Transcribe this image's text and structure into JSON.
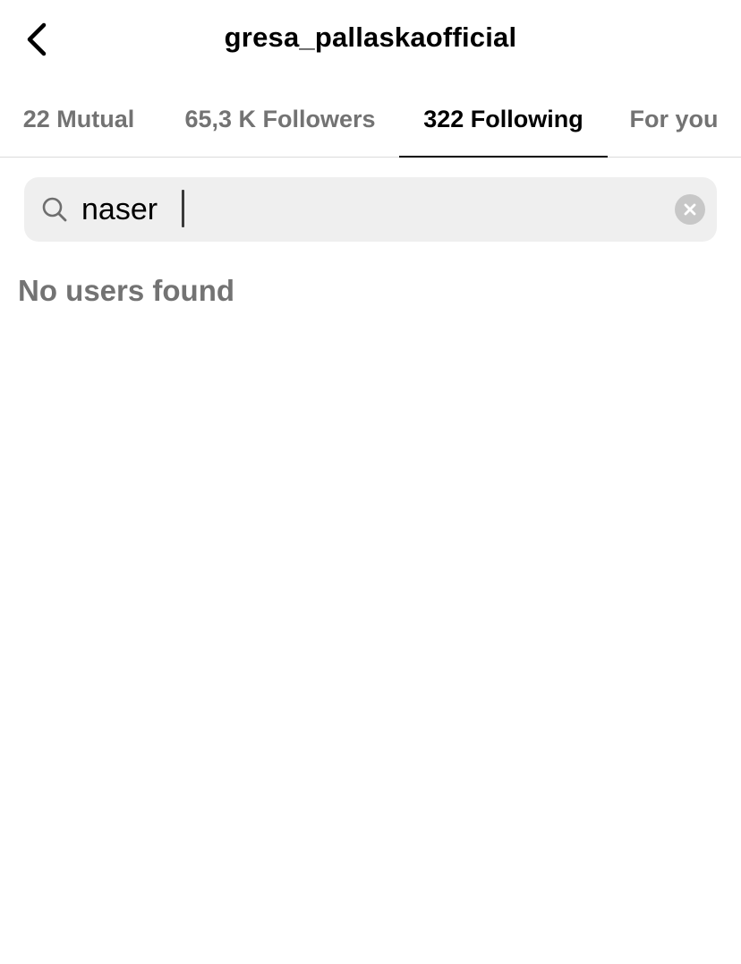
{
  "header": {
    "title": "gresa_pallaskaofficial",
    "back_icon": "chevron-left-icon"
  },
  "tabs": [
    {
      "label": "22 Mutual",
      "active": false
    },
    {
      "label": "65,3 K Followers",
      "active": false
    },
    {
      "label": "322 Following",
      "active": true
    },
    {
      "label": "For you",
      "active": false
    }
  ],
  "search": {
    "value": "naser",
    "icon": "search-icon",
    "clear_icon": "clear-icon"
  },
  "results": {
    "empty_message": "No users found"
  },
  "colors": {
    "text_primary": "#000000",
    "text_secondary": "#737373",
    "search_background": "#efefef",
    "divider": "#dbdbdb",
    "clear_button": "#c7c7c7"
  }
}
